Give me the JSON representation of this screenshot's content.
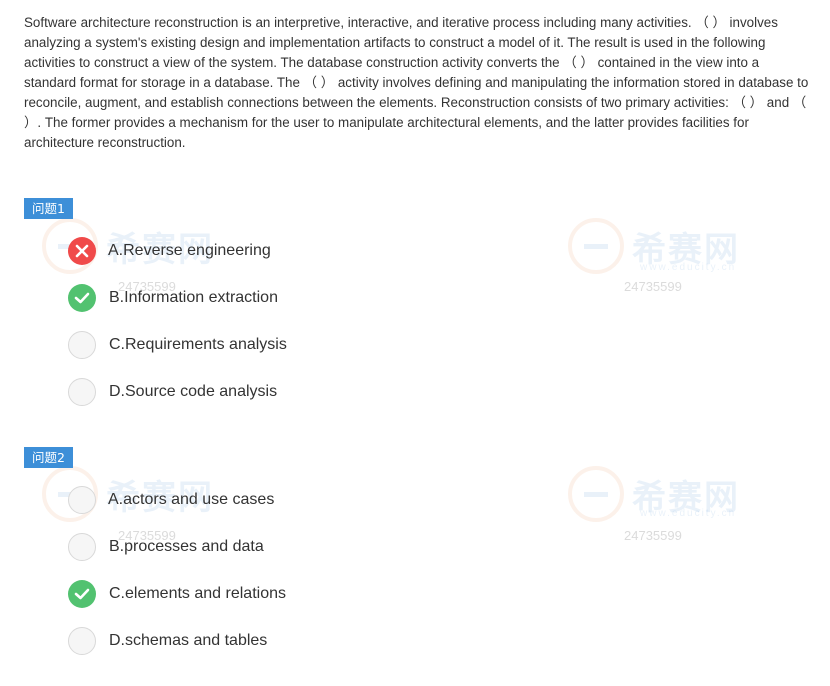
{
  "question": {
    "text": "Software architecture reconstruction is an interpretive, interactive, and iterative process including many activities. （ ） involves analyzing a system's existing design and implementation artifacts to construct a model of it. The result is used in the following activities to construct a view of the system. The database construction activity converts the （ ） contained in the view into a standard format for storage in a database. The （ ） activity involves defining and manipulating the information stored in database to reconcile, augment, and establish connections between the elements. Reconstruction consists of two primary activities: （ ） and （ ）. The former provides a mechanism for the user to manipulate architectural elements, and the latter provides facilities for architecture reconstruction."
  },
  "watermark": {
    "brand": "希赛网",
    "site": "www.educity.cn",
    "id": "24735599",
    "colors": {
      "ring": "#e07020",
      "text": "#1a6fc4"
    }
  },
  "sections": [
    {
      "badge": "问题1",
      "options": [
        {
          "label": "A.Reverse engineering",
          "state": "wrong",
          "icon": "x-icon"
        },
        {
          "label": "B.Information extraction",
          "state": "correct",
          "icon": "check-icon"
        },
        {
          "label": "C.Requirements analysis",
          "state": "empty"
        },
        {
          "label": "D.Source code analysis",
          "state": "empty"
        }
      ]
    },
    {
      "badge": "问题2",
      "options": [
        {
          "label": "A.actors and use cases",
          "state": "empty"
        },
        {
          "label": "B.processes and data",
          "state": "empty"
        },
        {
          "label": "C.elements and relations",
          "state": "correct",
          "icon": "check-icon"
        },
        {
          "label": "D.schemas and tables",
          "state": "empty"
        }
      ]
    }
  ],
  "colors": {
    "badge": "#3d8fd8",
    "correct": "#52c270",
    "wrong": "#f04a4a",
    "text": "#333333"
  }
}
